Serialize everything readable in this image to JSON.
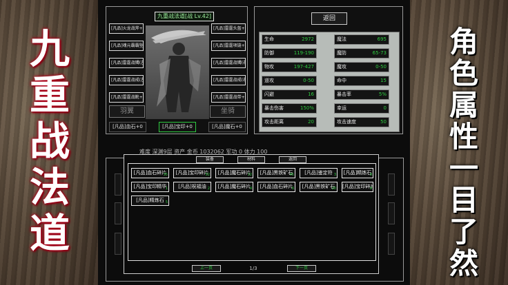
{
  "left_banner": {
    "chars": [
      "九",
      "重",
      "战",
      "法",
      "道"
    ]
  },
  "right_banner": {
    "chars": [
      "角",
      "色",
      "属",
      "性",
      "一",
      "目",
      "了",
      "然"
    ]
  },
  "equip": {
    "title": "九重战法道[战 Lv.42]",
    "left_slots": [
      "[凡品]火龙战斧+0",
      "[凡品]魂元霸霸坠+0",
      "[凡品]雷霆战镯(左)+0",
      "[凡品]雷霆战戒(左)+0",
      "[凡品]雷霆战靴+0"
    ],
    "right_slots": [
      "[凡品]雷霆头盔+0",
      "[凡品]雷霆项链+0",
      "[凡品]雷霆战镯(右)+0",
      "[凡品]雷霆战戒(右)+0",
      "[凡品]雷霆战带+0"
    ],
    "wings_label": "羽翼",
    "mount_label": "坐骑",
    "bottom_slots": [
      "[凡品]血石+0",
      "[凡品]宝印+0",
      "[凡品]魔石+0"
    ]
  },
  "stats": {
    "back_label": "返回",
    "rows": [
      {
        "label": "生命",
        "value": "2972"
      },
      {
        "label": "魔法",
        "value": "695"
      },
      {
        "label": "防御",
        "value": "119-190"
      },
      {
        "label": "魔防",
        "value": "65-73"
      },
      {
        "label": "物攻",
        "value": "197-427"
      },
      {
        "label": "魔攻",
        "value": "0-50"
      },
      {
        "label": "道攻",
        "value": "0-50"
      },
      {
        "label": "命中",
        "value": "15"
      },
      {
        "label": "闪避",
        "value": "16"
      },
      {
        "label": "暴击率",
        "value": "5%"
      },
      {
        "label": "暴击伤害",
        "value": "150%"
      },
      {
        "label": "幸运",
        "value": "0"
      },
      {
        "label": "攻击距离",
        "value": "20"
      },
      {
        "label": "攻击速度",
        "value": "50"
      }
    ]
  },
  "status_line": "难度 深渊9层  资产 金币 1032062  军功 0  体力 100",
  "inventory": {
    "tabs": [
      "装备",
      "材料",
      "返回"
    ],
    "items": [
      {
        "name": "[凡品]血石碎片",
        "count": "35"
      },
      {
        "name": "[凡品]宝印碎片",
        "count": "52"
      },
      {
        "name": "[凡品]魔石碎片",
        "count": "12"
      },
      {
        "name": "[凡品]黑铁矿石",
        "count": "45"
      },
      {
        "name": "[凡品]鉴定符",
        "count": "3"
      },
      {
        "name": "[凡品]精炼石",
        "count": "8"
      },
      {
        "name": "[凡品]宝印精华",
        "count": "1"
      },
      {
        "name": "[凡品]祝福油",
        "count": "2"
      },
      {
        "name": "[凡品]魔石碎片",
        "count": "4"
      },
      {
        "name": "[凡品]血石碎片",
        "count": "6"
      },
      {
        "name": "[凡品]黑铁矿石",
        "count": "20"
      },
      {
        "name": "[凡品]宝印碎片",
        "count": "9"
      },
      {
        "name": "[凡品]精炼石",
        "count": "5"
      }
    ],
    "prev_label": "上一页",
    "next_label": "下一页",
    "page": "1/3"
  },
  "colors": {
    "accent_green": "#2ecc40",
    "glow_red": "#b0001a"
  }
}
